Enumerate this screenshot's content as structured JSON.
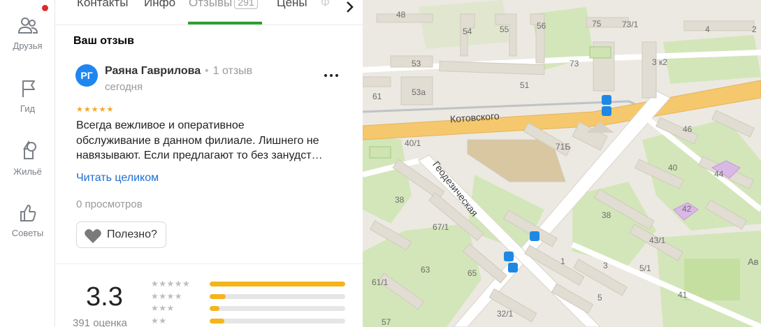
{
  "rail": {
    "items": [
      {
        "label": "Друзья",
        "icon": "friends-icon"
      },
      {
        "label": "Гид",
        "icon": "flag-icon"
      },
      {
        "label": "Жильё",
        "icon": "house-tree-icon"
      },
      {
        "label": "Советы",
        "icon": "thumbs-up-icon"
      }
    ]
  },
  "tabs": {
    "items": [
      "Контакты",
      "Инфо",
      "Отзывы",
      "Цены"
    ],
    "reviews_count": "291",
    "truncated": "Ф"
  },
  "review": {
    "section_title": "Ваш отзыв",
    "avatar_initials": "РГ",
    "author": "Раяна Гаврилова",
    "author_reviews": "1 отзыв",
    "date": "сегодня",
    "stars": "★★★★★",
    "rating": 5,
    "text_lines": [
      "Всегда вежливое и оперативное",
      "обслуживание в данном филиале. Лишнего не",
      "навязывают. Если предлагают то без занудст…"
    ],
    "read_more": "Читать целиком",
    "views": "0 просмотров",
    "useful": "Полезно?"
  },
  "summary": {
    "rating": "3.3",
    "count_label": "391 оценка",
    "distribution": [
      {
        "stars": 5,
        "fraction": 1.0
      },
      {
        "stars": 4,
        "fraction": 0.12
      },
      {
        "stars": 3,
        "fraction": 0.07
      },
      {
        "stars": 2,
        "fraction": 0.11
      }
    ]
  },
  "map": {
    "streets": [
      "Котовского",
      "Геодезическая"
    ],
    "building_numbers": [
      "48",
      "54",
      "55",
      "56",
      "75",
      "73/1",
      "4",
      "2",
      "53",
      "73",
      "3 к2",
      "53а",
      "51",
      "61",
      "40/1",
      "71Б",
      "46",
      "40",
      "44",
      "42",
      "38",
      "67/1",
      "38",
      "43/1",
      "63",
      "65",
      "1",
      "3",
      "5/1",
      "61/1",
      "5",
      "41",
      "32/1",
      "57",
      "Ав"
    ],
    "colors": {
      "road": "#f6c86d",
      "block": "#ece9e2",
      "park": "#cfe3b3",
      "transit": "#1e88e5"
    }
  }
}
